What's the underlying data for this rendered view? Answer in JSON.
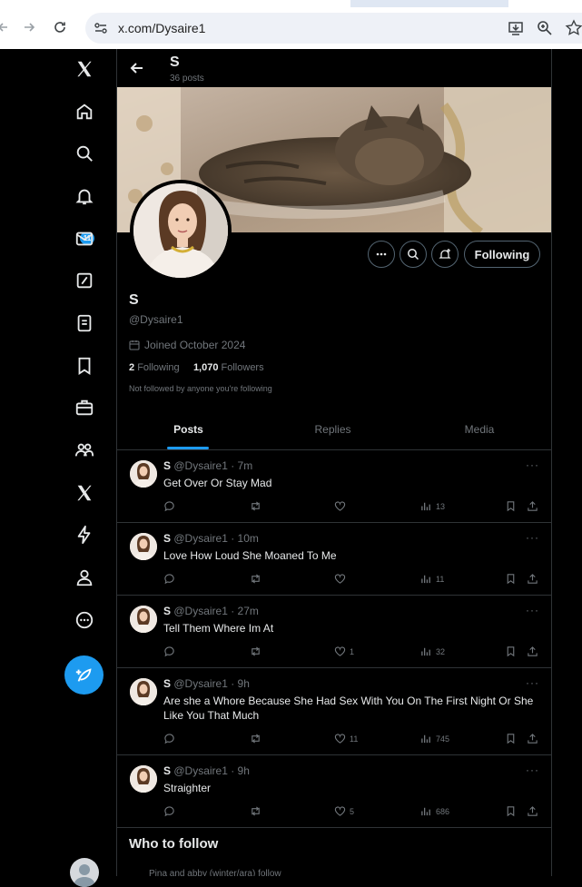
{
  "browser": {
    "url": "x.com/Dysaire1"
  },
  "nav": {
    "notification_count": "11"
  },
  "header": {
    "name": "S",
    "post_count": "36 posts"
  },
  "profile": {
    "name": "S",
    "handle": "@Dysaire1",
    "joined": "Joined October 2024",
    "following_count": "2",
    "following_label": "Following",
    "followers_count": "1,070",
    "followers_label": "Followers",
    "not_followed": "Not followed by anyone you're following",
    "follow_button": "Following"
  },
  "tabs": [
    "Posts",
    "Replies",
    "Media"
  ],
  "posts": [
    {
      "name": "S",
      "meta": "@Dysaire1 · 7m",
      "text": "Get Over Or Stay Mad",
      "likes": "",
      "views": "13"
    },
    {
      "name": "S",
      "meta": "@Dysaire1 · 10m",
      "text": "Love How Loud She Moaned To Me",
      "likes": "",
      "views": "11"
    },
    {
      "name": "S",
      "meta": "@Dysaire1 · 27m",
      "text": "Tell Them Where Im At",
      "likes": "1",
      "views": "32"
    },
    {
      "name": "S",
      "meta": "@Dysaire1 · 9h",
      "text": "Are she a Whore Because She Had Sex With You On The First Night Or She Like You That Much",
      "likes": "11",
      "views": "745"
    },
    {
      "name": "S",
      "meta": "@Dysaire1 · 9h",
      "text": "Straighter",
      "likes": "5",
      "views": "686"
    }
  ],
  "who_to_follow": {
    "title": "Who to follow",
    "peek": "Pina and abby (winter/ara) follow"
  },
  "colors": {
    "accent": "#1d9bf0",
    "background": "#000000",
    "border": "#2f3336",
    "muted_text": "#71767b"
  }
}
